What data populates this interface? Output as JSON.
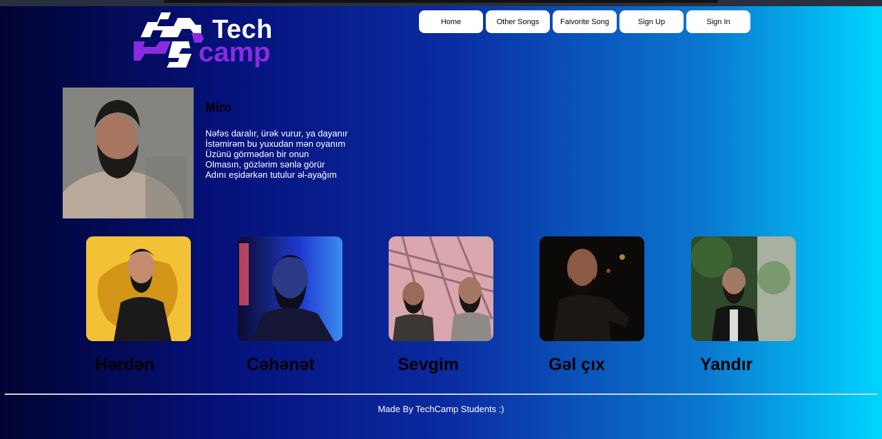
{
  "logo": {
    "line1": "Tech",
    "line2": "camp"
  },
  "nav": {
    "items": [
      {
        "label": "Home"
      },
      {
        "label": "Other Songs"
      },
      {
        "label": "Faivorite Song"
      },
      {
        "label": "Sign Up"
      },
      {
        "label": "Sign In"
      }
    ]
  },
  "artist": {
    "name": "Miro",
    "lyrics": [
      "Nəfəs daralır, ürək vurur, ya dayanır",
      "İstəmirəm bu yuxudan mən oyanım",
      "Üzünü görmədən bir onun",
      "Olmasın, gözlərim sənlə görür",
      "Adını eşidərkən tutulur əl-ayağım"
    ]
  },
  "songs": [
    {
      "title": "Hərdən"
    },
    {
      "title": "Cəhənət"
    },
    {
      "title": "Sevgim"
    },
    {
      "title": "Gəl çıx"
    },
    {
      "title": "Yandır"
    }
  ],
  "footer": {
    "text": "Made By TechCamp Students :)"
  },
  "colors": {
    "gradient_start": "#010432",
    "gradient_end": "#00d5ff",
    "logo_purple": "#8a2be2",
    "nav_button_bg": "#ffffff"
  }
}
